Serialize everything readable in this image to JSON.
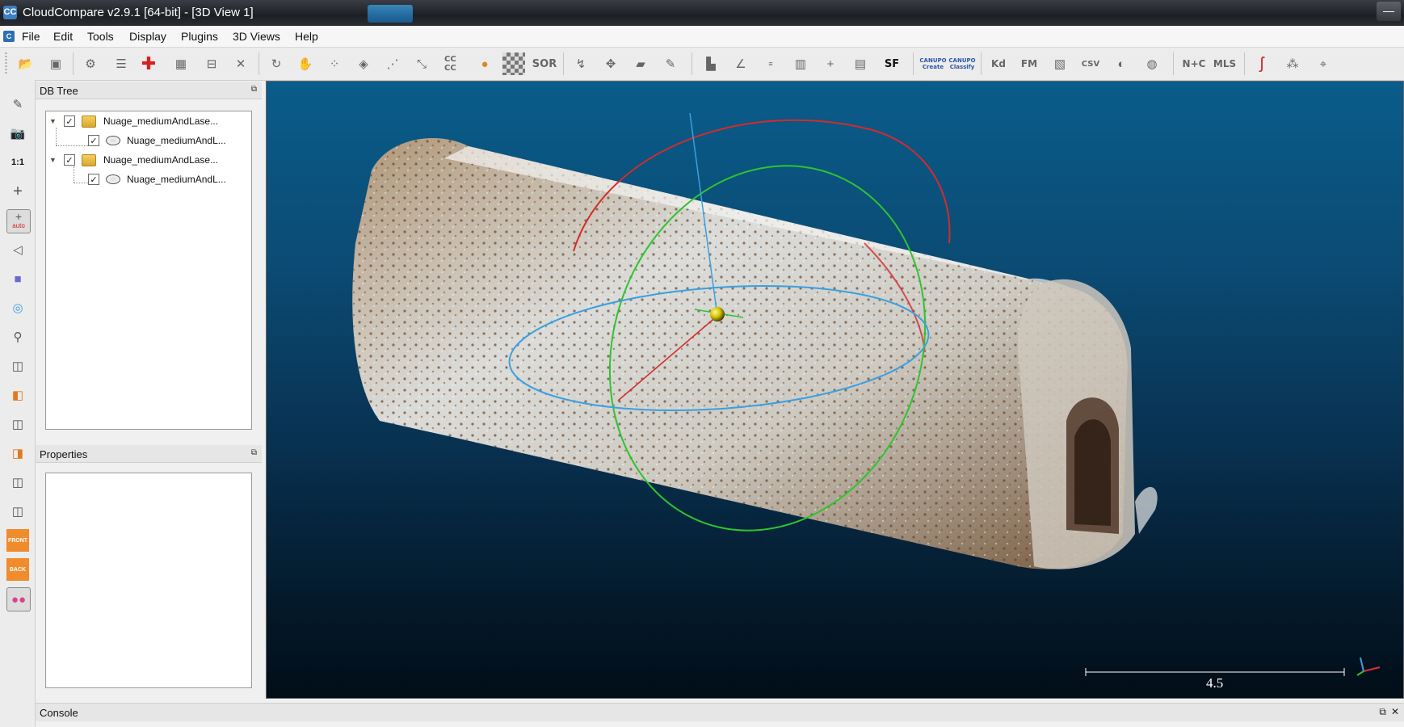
{
  "window": {
    "title": "CloudCompare v2.9.1 [64-bit] - [3D View 1]",
    "app_icon": "CC",
    "minimize_label": "—"
  },
  "menu": [
    "File",
    "Edit",
    "Tools",
    "Display",
    "Plugins",
    "3D Views",
    "Help"
  ],
  "toolbar": {
    "text_buttons": {
      "cc": "CC CC",
      "sor": "SOR",
      "sf": "SF",
      "canupo_create": "CANUPO Create",
      "canupo_classify": "CANUPO Classify",
      "kd": "Kd",
      "fm": "FM",
      "csv": "CSV",
      "nc": "N+C",
      "mls": "MLS"
    }
  },
  "left_toolbar": {
    "ratio_label": "1:1",
    "auto_label": "auto",
    "front_label": "FRONT",
    "back_label": "BACK"
  },
  "db_tree": {
    "title": "DB Tree",
    "items": [
      {
        "label": "Nuage_mediumAndLase...",
        "checked": true,
        "type": "folder",
        "level": 0
      },
      {
        "label": "Nuage_mediumAndL...",
        "checked": true,
        "type": "cloud",
        "level": 1
      },
      {
        "label": "Nuage_mediumAndLase...",
        "checked": true,
        "type": "folder",
        "level": 0
      },
      {
        "label": "Nuage_mediumAndL...",
        "checked": true,
        "type": "cloud",
        "level": 1
      }
    ]
  },
  "properties": {
    "title": "Properties"
  },
  "view": {
    "scale_value": "4.5",
    "background_top": "#0a5c8a",
    "background_bottom": "#020d18"
  },
  "console": {
    "title": "Console",
    "float_label": "⧉",
    "close_label": "✕"
  },
  "colors": {
    "trackball_red": "#d42b2b",
    "trackball_green": "#2ec42e",
    "trackball_blue": "#3aa0e0"
  }
}
